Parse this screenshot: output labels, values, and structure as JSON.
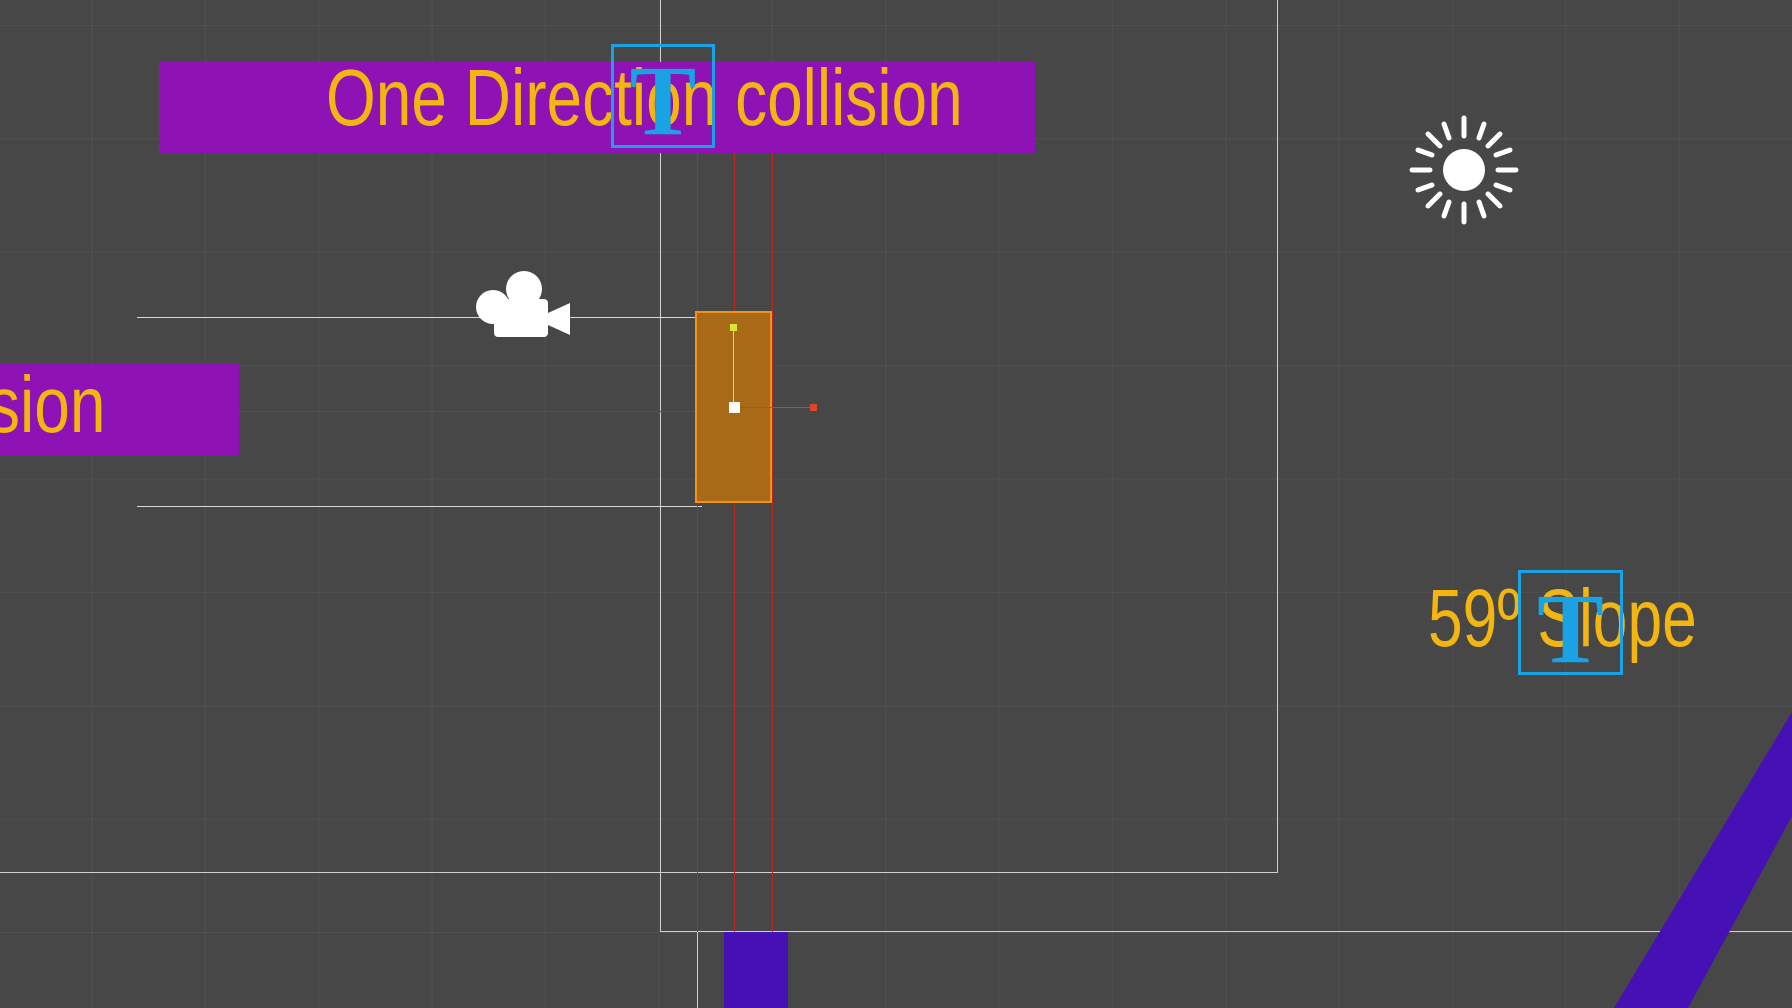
{
  "scene": {
    "labels": {
      "top_title": "One Direction collision",
      "left_partial": "sion",
      "slope_text": "59º Slope"
    },
    "gizmo_glyph": "T",
    "icons": {
      "camera": "camera-gizmo-icon",
      "light": "directional-light-icon"
    },
    "colors": {
      "background": "#474747",
      "label_text": "#f3b611",
      "label_background": "#8e12b4",
      "text_gizmo": "#19a2e4",
      "player": "#a86a17",
      "player_border": "#f0931b",
      "platform": "#4511b5",
      "collider_lines": "#b8281e"
    }
  }
}
